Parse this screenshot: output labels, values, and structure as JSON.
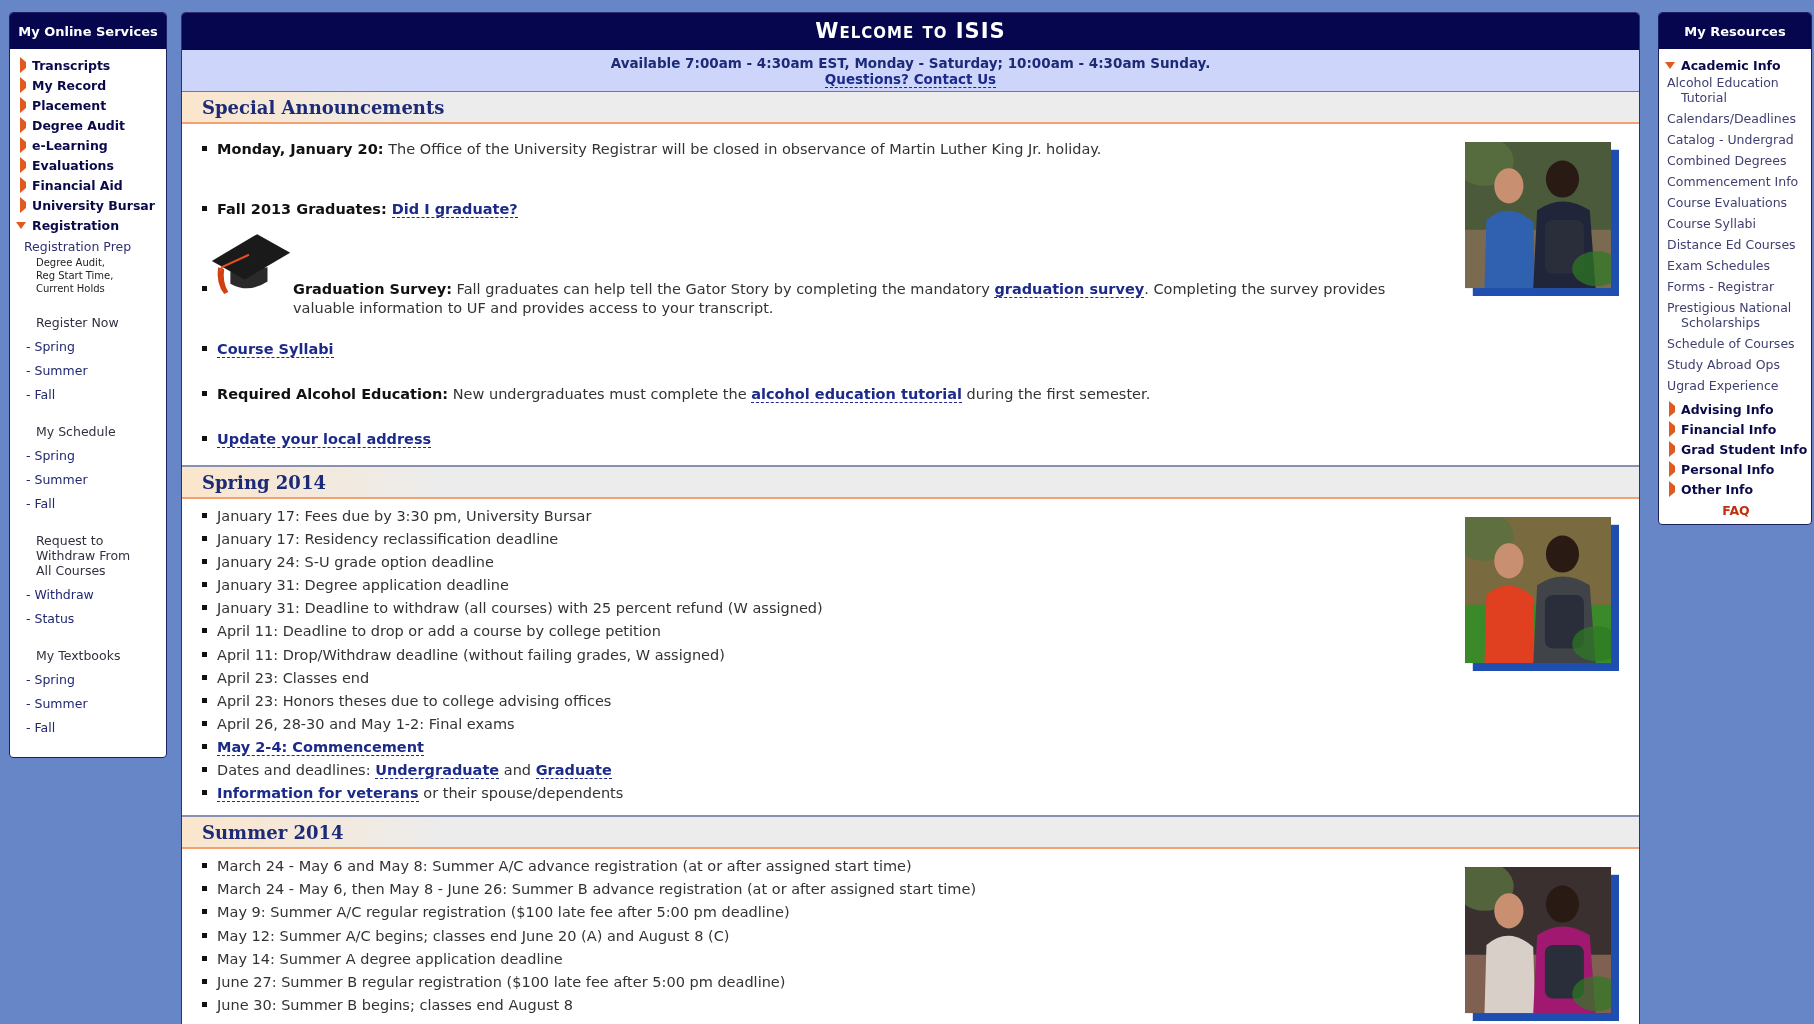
{
  "left_sidebar": {
    "title": "My Online Services",
    "items": [
      {
        "kind": "section",
        "label": "Transcripts",
        "expanded": false
      },
      {
        "kind": "section",
        "label": "My Record",
        "expanded": false
      },
      {
        "kind": "section",
        "label": "Placement",
        "expanded": false
      },
      {
        "kind": "section",
        "label": "Degree Audit",
        "expanded": false
      },
      {
        "kind": "section",
        "label": "e-Learning",
        "expanded": false
      },
      {
        "kind": "section",
        "label": "Evaluations",
        "expanded": false
      },
      {
        "kind": "section",
        "label": "Financial Aid",
        "expanded": false
      },
      {
        "kind": "section",
        "label": "University Bursar",
        "expanded": false
      },
      {
        "kind": "section",
        "label": "Registration",
        "expanded": true
      },
      {
        "kind": "prep",
        "label": "Registration Prep"
      },
      {
        "kind": "note",
        "label": "Degree Audit, Reg Start Time, Current Holds"
      },
      {
        "kind": "group",
        "label": "Register Now"
      },
      {
        "kind": "link",
        "label": "- Spring"
      },
      {
        "kind": "link",
        "label": "- Summer"
      },
      {
        "kind": "link",
        "label": "- Fall"
      },
      {
        "kind": "group",
        "label": "My Schedule"
      },
      {
        "kind": "link",
        "label": "- Spring"
      },
      {
        "kind": "link",
        "label": "- Summer"
      },
      {
        "kind": "link",
        "label": "- Fall"
      },
      {
        "kind": "group",
        "label": "Request to Withdraw From All Courses"
      },
      {
        "kind": "link",
        "label": "- Withdraw"
      },
      {
        "kind": "link",
        "label": "- Status"
      },
      {
        "kind": "group",
        "label": "My Textbooks"
      },
      {
        "kind": "link",
        "label": "- Spring"
      },
      {
        "kind": "link",
        "label": "- Summer"
      },
      {
        "kind": "link",
        "label": "- Fall"
      }
    ]
  },
  "main": {
    "title": "Welcome to ISIS",
    "availability": "Available 7:00am - 4:30am EST, Monday - Saturday; 10:00am - 4:30am Sunday.",
    "contact_link": "Questions? Contact Us",
    "sections": [
      {
        "title": "Special Announcements",
        "items": [
          {
            "kind": "text",
            "parts": [
              {
                "kind": "bold",
                "text": "Monday, January 20:"
              },
              {
                "kind": "plain",
                "text": " The Office of the University Registrar will be closed in observance of Martin Luther King Jr. holiday."
              }
            ]
          },
          {
            "kind": "text",
            "parts": [
              {
                "kind": "bold",
                "text": "Fall 2013 Graduates: "
              },
              {
                "kind": "link",
                "text": "Did I graduate?"
              }
            ]
          },
          {
            "kind": "cap",
            "parts": [
              {
                "kind": "bold",
                "text": "Graduation Survey:"
              },
              {
                "kind": "plain",
                "text": " Fall graduates can help tell the Gator Story by completing the mandatory "
              },
              {
                "kind": "link",
                "text": "graduation survey"
              },
              {
                "kind": "plain",
                "text": ". Completing the survey provides valuable information to UF and provides access to your transcript."
              }
            ]
          },
          {
            "kind": "text",
            "parts": [
              {
                "kind": "link",
                "text": "Course Syllabi"
              }
            ]
          },
          {
            "kind": "text",
            "parts": [
              {
                "kind": "bold",
                "text": "Required Alcohol Education:"
              },
              {
                "kind": "plain",
                "text": " New undergraduates must complete the "
              },
              {
                "kind": "link",
                "text": "alcohol education tutorial"
              },
              {
                "kind": "plain",
                "text": " during the first semester."
              }
            ]
          },
          {
            "kind": "text",
            "parts": [
              {
                "kind": "link",
                "text": "Update your local address"
              }
            ]
          }
        ]
      },
      {
        "title": "Spring 2014",
        "items": [
          {
            "kind": "text",
            "parts": [
              {
                "kind": "plain",
                "text": "January 17: Fees due by 3:30 pm, University Bursar"
              }
            ]
          },
          {
            "kind": "text",
            "parts": [
              {
                "kind": "plain",
                "text": "January 17: Residency reclassification deadline"
              }
            ]
          },
          {
            "kind": "text",
            "parts": [
              {
                "kind": "plain",
                "text": "January 24: S-U grade option deadline"
              }
            ]
          },
          {
            "kind": "text",
            "parts": [
              {
                "kind": "plain",
                "text": "January 31: Degree application deadline"
              }
            ]
          },
          {
            "kind": "text",
            "parts": [
              {
                "kind": "plain",
                "text": "January 31: Deadline to withdraw (all courses) with 25 percent refund (W assigned)"
              }
            ]
          },
          {
            "kind": "text",
            "parts": [
              {
                "kind": "plain",
                "text": "April 11: Deadline to drop or add a course by college petition"
              }
            ]
          },
          {
            "kind": "text",
            "parts": [
              {
                "kind": "plain",
                "text": "April 11: Drop/Withdraw deadline (without failing grades, W assigned)"
              }
            ]
          },
          {
            "kind": "text",
            "parts": [
              {
                "kind": "plain",
                "text": "April 23: Classes end"
              }
            ]
          },
          {
            "kind": "text",
            "parts": [
              {
                "kind": "plain",
                "text": "April 23: Honors theses due to college advising offices"
              }
            ]
          },
          {
            "kind": "text",
            "parts": [
              {
                "kind": "plain",
                "text": "April 26, 28-30 and May 1-2: Final exams"
              }
            ]
          },
          {
            "kind": "text",
            "parts": [
              {
                "kind": "link",
                "text": "May 2-4: Commencement"
              }
            ]
          },
          {
            "kind": "text",
            "parts": [
              {
                "kind": "plain",
                "text": "Dates and deadlines: "
              },
              {
                "kind": "link",
                "text": "Undergraduate"
              },
              {
                "kind": "plain",
                "text": " and "
              },
              {
                "kind": "link",
                "text": "Graduate"
              }
            ]
          },
          {
            "kind": "text",
            "parts": [
              {
                "kind": "link",
                "text": "Information for veterans"
              },
              {
                "kind": "plain",
                "text": " or their spouse/dependents"
              }
            ]
          }
        ]
      },
      {
        "title": "Summer 2014",
        "items": [
          {
            "kind": "text",
            "parts": [
              {
                "kind": "plain",
                "text": "March 24 - May 6 and May 8: Summer A/C advance registration (at or after assigned start time)"
              }
            ]
          },
          {
            "kind": "text",
            "parts": [
              {
                "kind": "plain",
                "text": "March 24 - May 6, then May 8 - June 26: Summer B advance registration (at or after assigned start time)"
              }
            ]
          },
          {
            "kind": "text",
            "parts": [
              {
                "kind": "plain",
                "text": "May 9: Summer A/C regular registration ($100 late fee after 5:00 pm deadline)"
              }
            ]
          },
          {
            "kind": "text",
            "parts": [
              {
                "kind": "plain",
                "text": "May 12: Summer A/C begins; classes end June 20 (A) and August 8 (C)"
              }
            ]
          },
          {
            "kind": "text",
            "parts": [
              {
                "kind": "plain",
                "text": "May 14: Summer A degree application deadline"
              }
            ]
          },
          {
            "kind": "text",
            "parts": [
              {
                "kind": "plain",
                "text": "June 27: Summer B regular registration ($100 late fee after 5:00 pm deadline)"
              }
            ]
          },
          {
            "kind": "text",
            "parts": [
              {
                "kind": "plain",
                "text": "June 30: Summer B begins; classes end August 8"
              }
            ]
          }
        ]
      }
    ]
  },
  "right_sidebar": {
    "title": "My Resources",
    "items": [
      {
        "kind": "section",
        "label": "Academic Info",
        "expanded": true
      },
      {
        "kind": "link",
        "label": "Alcohol Education Tutorial"
      },
      {
        "kind": "link",
        "label": "Calendars/Deadlines"
      },
      {
        "kind": "link",
        "label": "Catalog - Undergrad"
      },
      {
        "kind": "link",
        "label": "Combined Degrees"
      },
      {
        "kind": "link",
        "label": "Commencement Info"
      },
      {
        "kind": "link",
        "label": "Course Evaluations"
      },
      {
        "kind": "link",
        "label": "Course Syllabi"
      },
      {
        "kind": "link",
        "label": "Distance Ed Courses"
      },
      {
        "kind": "link",
        "label": "Exam Schedules"
      },
      {
        "kind": "link",
        "label": "Forms - Registrar"
      },
      {
        "kind": "link",
        "label": "Prestigious National Scholarships"
      },
      {
        "kind": "link",
        "label": "Schedule of Courses"
      },
      {
        "kind": "link",
        "label": "Study Abroad Ops"
      },
      {
        "kind": "link",
        "label": "Ugrad Experience"
      },
      {
        "kind": "section",
        "label": "Advising Info",
        "expanded": false
      },
      {
        "kind": "section",
        "label": "Financial Info",
        "expanded": false
      },
      {
        "kind": "section",
        "label": "Grad Student Info",
        "expanded": false
      },
      {
        "kind": "section",
        "label": "Personal Info",
        "expanded": false
      },
      {
        "kind": "section",
        "label": "Other Info",
        "expanded": false
      },
      {
        "kind": "faq",
        "label": "FAQ"
      }
    ]
  }
}
